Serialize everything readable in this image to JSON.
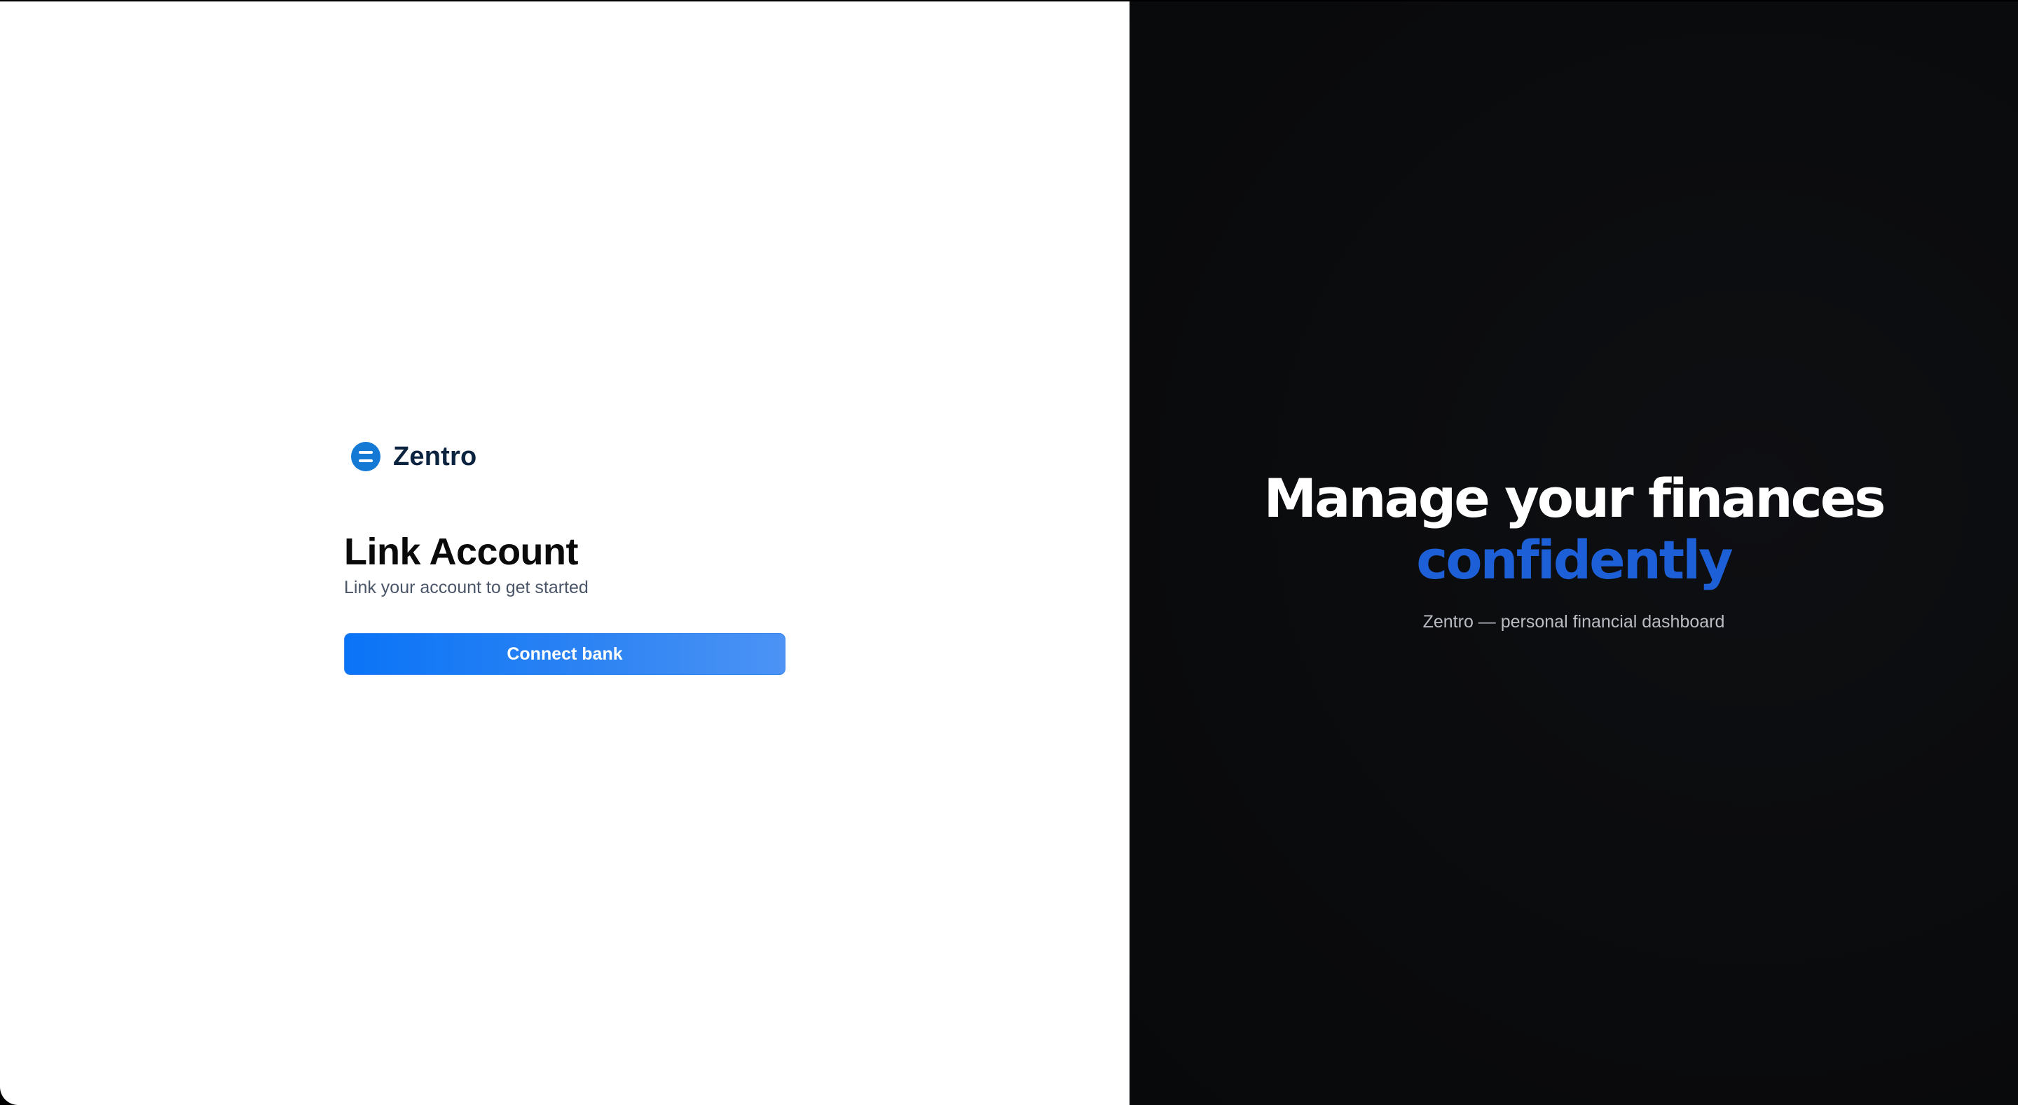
{
  "colors": {
    "accent": "#0a74f7",
    "brand_logo": "#1479d4",
    "hero_highlight": "#1d5fd6",
    "right_panel_bg": "#0a0b0d"
  },
  "brand": {
    "name": "Zentro",
    "logo_icon": "zentro-logo-icon"
  },
  "auth": {
    "title": "Link Account",
    "subtitle": "Link your account to get started",
    "connect_button_label": "Connect bank"
  },
  "hero": {
    "headline_line1": "Manage your finances",
    "headline_line2": "confidently",
    "caption": "Zentro — personal financial dashboard"
  }
}
